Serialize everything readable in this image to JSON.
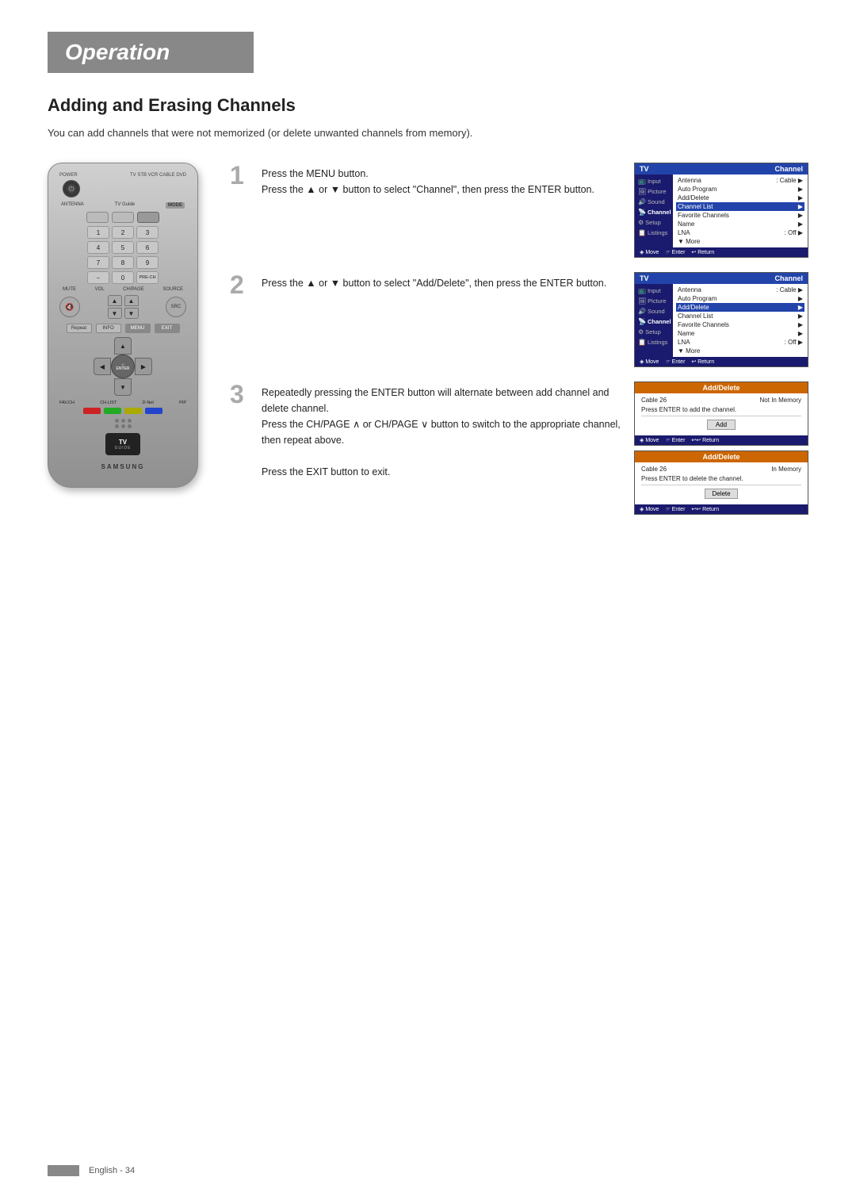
{
  "header": {
    "title": "Operation"
  },
  "section": {
    "title": "Adding and Erasing Channels",
    "intro": "You can add channels that were not memorized (or delete unwanted channels from memory)."
  },
  "steps": [
    {
      "number": "1",
      "text": "Press the MENU button.\nPress the ▲ or ▼ button to select \"Channel\", then press the ENTER button."
    },
    {
      "number": "2",
      "text": "Press the ▲ or ▼ button to select \"Add/Delete\", then press the ENTER button."
    },
    {
      "number": "3",
      "text": "Repeatedly pressing the ENTER button will alternate between add channel and delete channel.\nPress the CH/PAGE ∧ or CH/PAGE ∨ button to switch to the appropriate channel, then repeat above.\n\nPress the EXIT button to exit."
    }
  ],
  "screens": {
    "screen1": {
      "header_left": "TV",
      "header_right": "Channel",
      "items": [
        {
          "label": "Input",
          "sub": "Antenna",
          "value": ": Cable",
          "arrow": true,
          "highlighted": false
        },
        {
          "label": "Picture",
          "sub": "Auto Program",
          "arrow": true,
          "highlighted": false
        },
        {
          "label": "Sound",
          "sub": "Add/Delete",
          "arrow": true,
          "highlighted": false
        },
        {
          "label": "Channel",
          "sub": "Channel List",
          "arrow": true,
          "highlighted": true
        },
        {
          "label": "",
          "sub": "Favorite Channels",
          "arrow": true,
          "highlighted": false
        },
        {
          "label": "Setup",
          "sub": "Name",
          "arrow": true,
          "highlighted": false
        },
        {
          "label": "",
          "sub": "LNA",
          "value": ": Off",
          "arrow": true,
          "highlighted": false
        },
        {
          "label": "Listings",
          "sub": "▼ More",
          "highlighted": false
        }
      ],
      "footer": [
        "◈ Move",
        "☞ Enter",
        "↩ Return"
      ]
    },
    "screen2": {
      "header_left": "TV",
      "header_right": "Channel",
      "items": [
        {
          "label": "Input",
          "sub": "Antenna",
          "value": ": Cable",
          "arrow": true,
          "highlighted": false
        },
        {
          "label": "Picture",
          "sub": "Auto Program",
          "arrow": true,
          "highlighted": false
        },
        {
          "label": "Sound",
          "sub": "Add/Delete",
          "arrow": true,
          "highlighted": true
        },
        {
          "label": "Channel",
          "sub": "Channel List",
          "arrow": true,
          "highlighted": false
        },
        {
          "label": "",
          "sub": "Favorite Channels",
          "arrow": true,
          "highlighted": false
        },
        {
          "label": "Setup",
          "sub": "Name",
          "arrow": true,
          "highlighted": false
        },
        {
          "label": "",
          "sub": "LNA",
          "value": ": Off",
          "arrow": true,
          "highlighted": false
        },
        {
          "label": "Listings",
          "sub": "▼ More",
          "highlighted": false
        }
      ],
      "footer": [
        "◈ Move",
        "☞ Enter",
        "↩ Return"
      ]
    },
    "addScreen": {
      "header": "Add/Delete",
      "info_left": "Cable  26",
      "info_right": "Not In Memory",
      "message": "Press ENTER to add the channel.",
      "button": "Add",
      "footer": [
        "◈ Move",
        "☞ Enter",
        "↩↩ Return"
      ]
    },
    "deleteScreen": {
      "header": "Add/Delete",
      "info_left": "Cable  26",
      "info_right": "In Memory",
      "message": "Press ENTER to delete the channel.",
      "button": "Delete",
      "footer": [
        "◈ Move",
        "☞ Enter",
        "↩↩ Return"
      ]
    }
  },
  "remote": {
    "brand": "SAMSUNG",
    "buttons": {
      "power": "⏻",
      "antenna": "ANTENNA",
      "tvGuide": "TV Guide",
      "mode": "MODE",
      "numbers": [
        "1",
        "2",
        "3",
        "4",
        "5",
        "6",
        "7",
        "8",
        "9",
        "–",
        "0",
        "PRE-CH"
      ],
      "mute": "MUTE",
      "vol": "VOL",
      "chPage": "CH/PAGE",
      "source": "SOURCE",
      "favCh": "FAV.CH",
      "chList": "CH.LIST",
      "dNet": "D-Net",
      "enter": "ENTER"
    }
  },
  "footer": {
    "text": "English - 34"
  }
}
